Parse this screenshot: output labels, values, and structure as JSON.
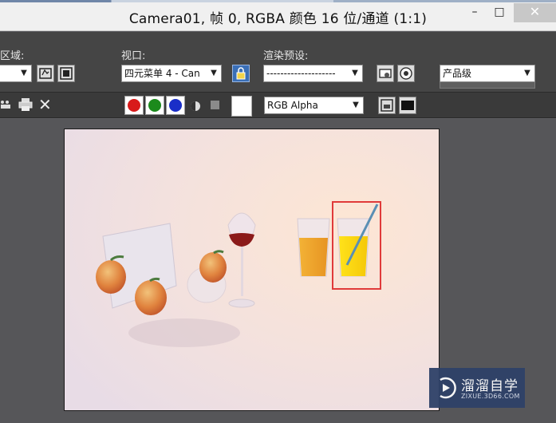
{
  "window": {
    "title": "Camera01, 帧 0, RGBA 颜色 16 位/通道 (1:1)",
    "min_glyph": "–",
    "max_glyph": "□",
    "close_glyph": "✕"
  },
  "toolbar": {
    "area_label": "渲染区域:",
    "area_value": "",
    "viewport_label": "视口:",
    "viewport_value": "四元菜单 4 - Can",
    "preset_label": "渲染预设:",
    "preset_value": "--------------------",
    "render_button": "渲染",
    "quality_value": "产品级"
  },
  "channel_bar": {
    "channel_value": "RGB Alpha",
    "colors": {
      "red": "#d81a1a",
      "green": "#1c8a1c",
      "blue": "#1a2ec8"
    }
  },
  "watermark": {
    "title": "溜溜自学",
    "url": "ZIXUE.3D66.COM"
  }
}
